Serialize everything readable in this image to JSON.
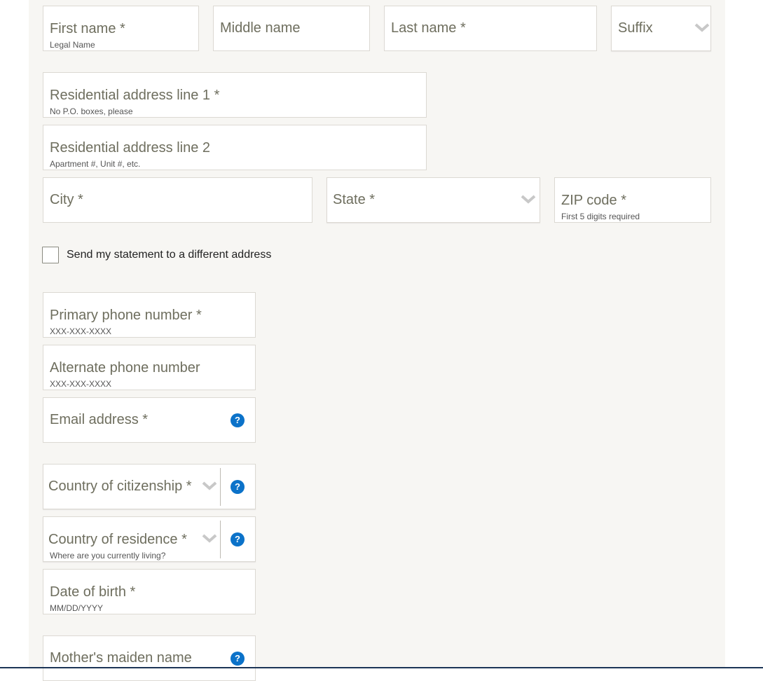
{
  "name": {
    "first": {
      "label": "First name *",
      "hint": "Legal Name"
    },
    "middle": {
      "label": "Middle name"
    },
    "last": {
      "label": "Last name *"
    },
    "suffix": {
      "label": "Suffix",
      "icon": "chevron-down-icon"
    }
  },
  "address": {
    "line1": {
      "label": "Residential address line 1 *",
      "hint": "No P.O. boxes, please"
    },
    "line2": {
      "label": "Residential address line 2",
      "hint": "Apartment #, Unit #, etc."
    },
    "city": {
      "label": "City *"
    },
    "state": {
      "label": "State *",
      "icon": "chevron-down-icon"
    },
    "zip": {
      "label": "ZIP code *",
      "hint": "First 5 digits required"
    }
  },
  "different_address": {
    "label": "Send my statement to a different address",
    "checked": false
  },
  "contact": {
    "primary_phone": {
      "label": "Primary phone number *",
      "hint": "XXX-XXX-XXXX"
    },
    "alternate_phone": {
      "label": "Alternate phone number",
      "hint": "XXX-XXX-XXXX"
    },
    "email": {
      "label": "Email address *",
      "help": "?"
    }
  },
  "identity": {
    "citizenship": {
      "label": "Country of citizenship *",
      "help": "?"
    },
    "residence": {
      "label": "Country of residence *",
      "hint": "Where are you currently living?",
      "help": "?"
    },
    "dob": {
      "label": "Date of birth *",
      "hint": "MM/DD/YYYY"
    },
    "maiden_name": {
      "label": "Mother's maiden name",
      "help": "?"
    }
  },
  "colors": {
    "panel_bg": "#f7f6f3",
    "field_border": "#dcd9d3",
    "label_text": "#6e6e5e",
    "help_icon": "#0b72c9"
  }
}
